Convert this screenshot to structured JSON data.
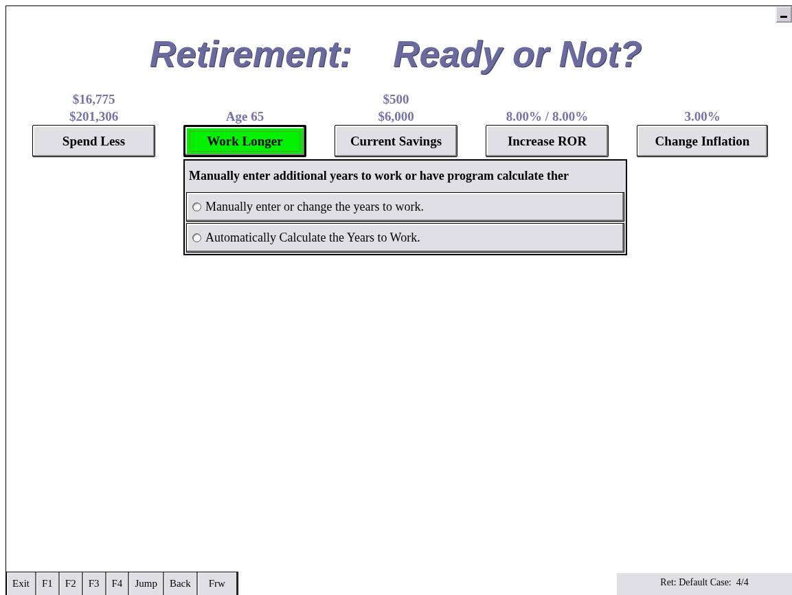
{
  "title": {
    "part_1": "Retirement:",
    "part_2": "Ready or Not?"
  },
  "options": [
    {
      "values": [
        "$16,775",
        "$201,306"
      ],
      "label": "Spend Less",
      "selected": false
    },
    {
      "values": [
        "Age 65"
      ],
      "label": "Work Longer",
      "selected": true
    },
    {
      "values": [
        "$500",
        "$6,000"
      ],
      "label": "Current Savings",
      "selected": false
    },
    {
      "values": [
        "8.00% / 8.00%"
      ],
      "label": "Increase ROR",
      "selected": false
    },
    {
      "values": [
        "3.00%"
      ],
      "label": "Change Inflation",
      "selected": false
    }
  ],
  "panel": {
    "heading": "Manually enter additional years to work or have program calculate ther",
    "choices": [
      {
        "label": "Manually enter or change the years to work.",
        "selected": false
      },
      {
        "label": "Automatically Calculate the Years to Work.",
        "selected": false
      }
    ]
  },
  "toolbar": [
    {
      "label": "Exit"
    },
    {
      "label": "F1"
    },
    {
      "label": "F2"
    },
    {
      "label": "F3"
    },
    {
      "label": "F4"
    },
    {
      "label": "Jump"
    },
    {
      "label": "Back"
    },
    {
      "label": "Frw"
    }
  ],
  "status_bar": "Ret: Default Case:  4/4"
}
